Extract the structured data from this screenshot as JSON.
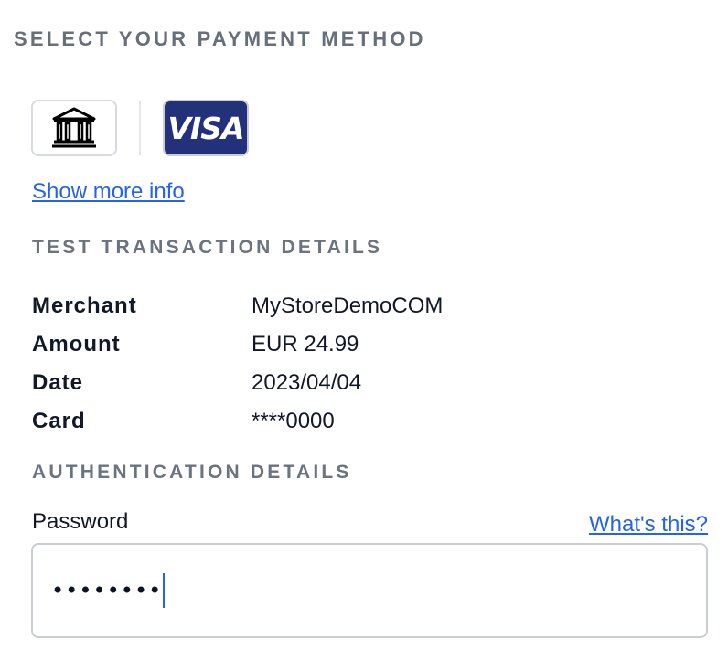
{
  "payment": {
    "heading": "SELECT YOUR PAYMENT METHOD",
    "methods": [
      {
        "name": "bank",
        "icon": "bank-icon"
      },
      {
        "name": "visa",
        "label": "VISA",
        "color": "#23307a"
      }
    ],
    "show_more_link": "Show more info"
  },
  "transaction": {
    "heading": "TEST TRANSACTION DETAILS",
    "rows": [
      {
        "label": "Merchant",
        "value": "MyStoreDemoCOM"
      },
      {
        "label": "Amount",
        "value": "EUR 24.99"
      },
      {
        "label": "Date",
        "value": "2023/04/04"
      },
      {
        "label": "Card",
        "value": "****0000"
      }
    ]
  },
  "auth": {
    "heading": "AUTHENTICATION DETAILS",
    "password_label": "Password",
    "help_link": "What's this?",
    "password_value": "••••••••"
  },
  "colors": {
    "link": "#2563eb",
    "heading": "#6b7280",
    "visa_bg": "#23307a"
  }
}
